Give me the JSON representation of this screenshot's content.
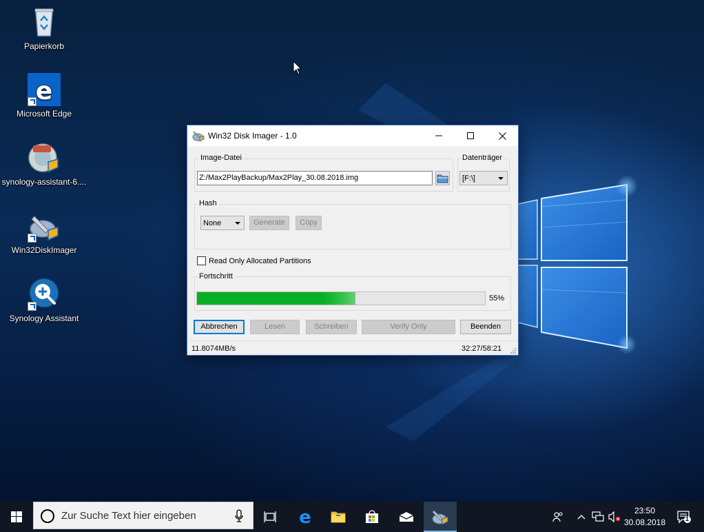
{
  "desktop": {
    "icons": [
      {
        "label": "Papierkorb",
        "icon": "recycle-bin-icon"
      },
      {
        "label": "Microsoft Edge",
        "icon": "edge-icon"
      },
      {
        "label": "synology-assistant-6....",
        "icon": "synology-installer-icon"
      },
      {
        "label": "Win32DiskImager",
        "icon": "disk-imager-icon"
      },
      {
        "label": "Synology Assistant",
        "icon": "synology-assistant-icon"
      }
    ]
  },
  "window": {
    "title": "Win32 Disk Imager - 1.0",
    "image_group_label": "Image-Datei",
    "image_path": "Z:/Max2PlayBackup/Max2Play_30.08.2018.img",
    "device_group_label": "Datenträger",
    "device_value": "[F:\\]",
    "hash_group_label": "Hash",
    "hash_value": "None",
    "generate_label": "Generate",
    "copy_label": "Copy",
    "readonly_label": "Read Only Allocated Partitions",
    "readonly_checked": false,
    "progress_group_label": "Fortschritt",
    "progress_percent": 55,
    "progress_text": "55%",
    "buttons": {
      "cancel": "Abbrechen",
      "read": "Lesen",
      "write": "Schreiben",
      "verify": "Verify Only",
      "exit": "Beenden"
    },
    "status": {
      "speed": "11.8074MB/s",
      "time": "32:27/58:21"
    }
  },
  "taskbar": {
    "search_placeholder": "Zur Suche Text hier eingeben",
    "apps": [
      "task-view-icon",
      "edge-icon",
      "file-explorer-icon",
      "store-icon",
      "mail-icon",
      "disk-imager-icon"
    ],
    "clock_time": "23:50",
    "clock_date": "30.08.2018",
    "notification_count": "1"
  },
  "colors": {
    "accent": "#0078d7",
    "progress": "#06b025",
    "taskbar": "#101722"
  }
}
